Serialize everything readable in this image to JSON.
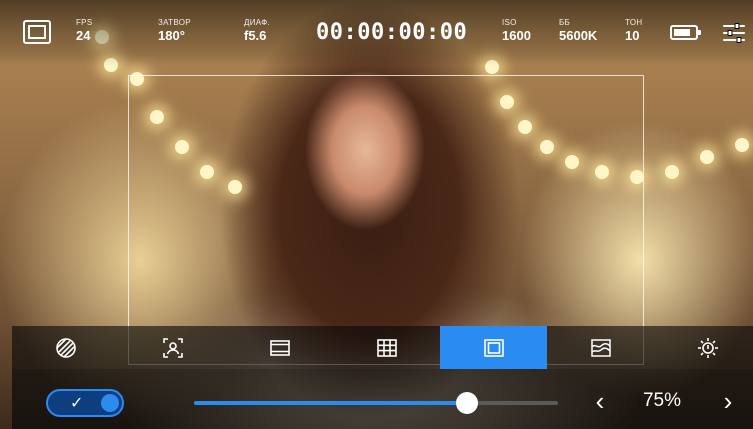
{
  "top_bar": {
    "fps": {
      "label": "FPS",
      "value": "24"
    },
    "shutter": {
      "label": "ЗАТВОР",
      "value": "180°"
    },
    "iris": {
      "label": "ДИАФ.",
      "value": "f5.6"
    },
    "timecode": "00:00:00:00",
    "iso": {
      "label": "ISO",
      "value": "1600"
    },
    "white_balance": {
      "label": "ББ",
      "value": "5600K"
    },
    "tint": {
      "label": "ТОН",
      "value": "10"
    },
    "battery_level": 0.85
  },
  "tool_strip": {
    "tools": [
      {
        "icon": "zebra-icon"
      },
      {
        "icon": "focus-assist-icon"
      },
      {
        "icon": "frame-guides-icon"
      },
      {
        "icon": "grid-icon"
      },
      {
        "icon": "safe-area-icon",
        "active": true
      },
      {
        "icon": "false-color-icon"
      },
      {
        "icon": "brightness-icon"
      }
    ],
    "active_color": "#2a8cf0"
  },
  "bottom_bar": {
    "toggle_on": true,
    "slider_percent": 75,
    "value_text": "75%",
    "prev_symbol": "‹",
    "next_symbol": "›"
  }
}
